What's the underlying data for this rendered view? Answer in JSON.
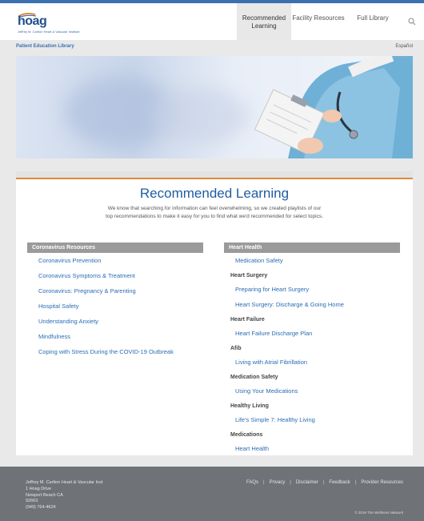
{
  "header": {
    "logo": {
      "word": "hoag",
      "sub": "Jeffrey M. Carlton Heart & Vascular Institute"
    },
    "nav": [
      {
        "label": "Recommended Learning",
        "active": true
      },
      {
        "label": "Facility Resources",
        "active": false
      },
      {
        "label": "Full Library",
        "active": false
      }
    ]
  },
  "library_bar": {
    "title": "Patient Education Library",
    "language_link": "Español"
  },
  "main": {
    "title": "Recommended Learning",
    "intro": "We know that searching for information can feel overwhelming, so we created playlists of our top recommendations to make it easy for you to find what we'd recommended for select topics.",
    "left_column": {
      "heading": "Coronavirus Resources",
      "items": [
        {
          "type": "link",
          "label": "Coronavirus Prevention"
        },
        {
          "type": "link",
          "label": "Coronavirus Symptoms & Treatment"
        },
        {
          "type": "link",
          "label": "Coronavirus: Pregnancy & Parenting"
        },
        {
          "type": "link",
          "label": "Hospital Safety"
        },
        {
          "type": "link",
          "label": "Understanding Anxiety"
        },
        {
          "type": "link",
          "label": "Mindfulness"
        },
        {
          "type": "link",
          "label": "Coping with Stress During the COVID-19 Outbreak"
        }
      ]
    },
    "right_column": {
      "heading": "Heart Health",
      "items": [
        {
          "type": "link",
          "label": "Medication Safety"
        },
        {
          "type": "sub",
          "label": "Heart Surgery"
        },
        {
          "type": "link",
          "label": "Preparing for Heart Surgery"
        },
        {
          "type": "link",
          "label": "Heart Surgery: Discharge & Going Home"
        },
        {
          "type": "sub",
          "label": "Heart Failure"
        },
        {
          "type": "link",
          "label": "Heart Failure Discharge Plan"
        },
        {
          "type": "sub",
          "label": "Afib"
        },
        {
          "type": "link",
          "label": "Living with Atrial Fibrillation"
        },
        {
          "type": "sub",
          "label": "Medication Safety"
        },
        {
          "type": "link",
          "label": "Using Your Medications"
        },
        {
          "type": "sub",
          "label": "Healthy Living"
        },
        {
          "type": "link",
          "label": "Life's Simple 7: Healthy Living"
        },
        {
          "type": "sub",
          "label": "Medications"
        },
        {
          "type": "link",
          "label": "Heart Health"
        }
      ]
    }
  },
  "footer": {
    "address": [
      "Jeffrey M. Carlton Heart & Vascular Inst",
      "1 Hoag Drive",
      "Newport Beach CA",
      "92663",
      "(949) 764-4624"
    ],
    "links": [
      "FAQs",
      "Privacy",
      "Disclaimer",
      "Feedback",
      "Provider Resources"
    ],
    "copyright": "© 2019 The Wellness Network"
  },
  "colors": {
    "brand_blue": "#1f5ca3",
    "link_blue": "#2a6db5",
    "accent_orange": "#e08a3c",
    "column_head_gray": "#9a9a9b",
    "footer_gray": "#6f7277"
  }
}
